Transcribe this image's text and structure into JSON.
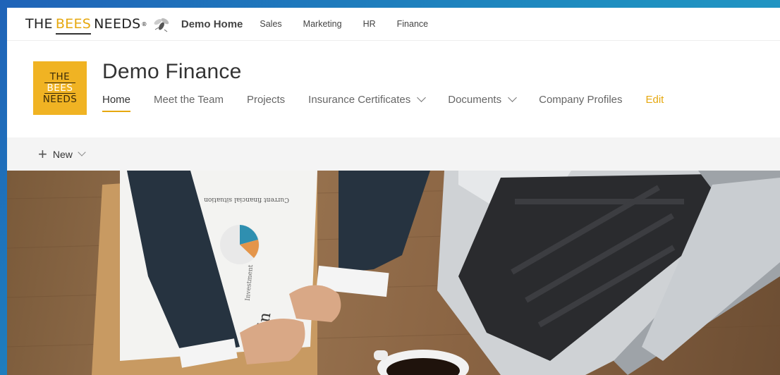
{
  "hub": {
    "brand": {
      "part1": "THE",
      "part2": "BEES",
      "part3": "NEEDS",
      "mark": "®"
    },
    "links": [
      "Demo Home",
      "Sales",
      "Marketing",
      "HR",
      "Finance"
    ]
  },
  "site": {
    "logo_lines": [
      "THE",
      "BEES",
      "NEEDS"
    ],
    "title": "Demo Finance",
    "nav": [
      {
        "label": "Home",
        "active": true,
        "dropdown": false
      },
      {
        "label": "Meet the Team",
        "active": false,
        "dropdown": false
      },
      {
        "label": "Projects",
        "active": false,
        "dropdown": false
      },
      {
        "label": "Insurance Certificates",
        "active": false,
        "dropdown": true
      },
      {
        "label": "Documents",
        "active": false,
        "dropdown": true
      },
      {
        "label": "Company Profiles",
        "active": false,
        "dropdown": false
      }
    ],
    "edit_label": "Edit"
  },
  "commandbar": {
    "new_label": "New"
  },
  "hero": {
    "paper_text": [
      "Current financial situation",
      "Fin",
      "Investment"
    ]
  },
  "colors": {
    "accent": "#e6a80f",
    "logo_bg": "#f0b323",
    "page_bg": "#1f63b8"
  }
}
